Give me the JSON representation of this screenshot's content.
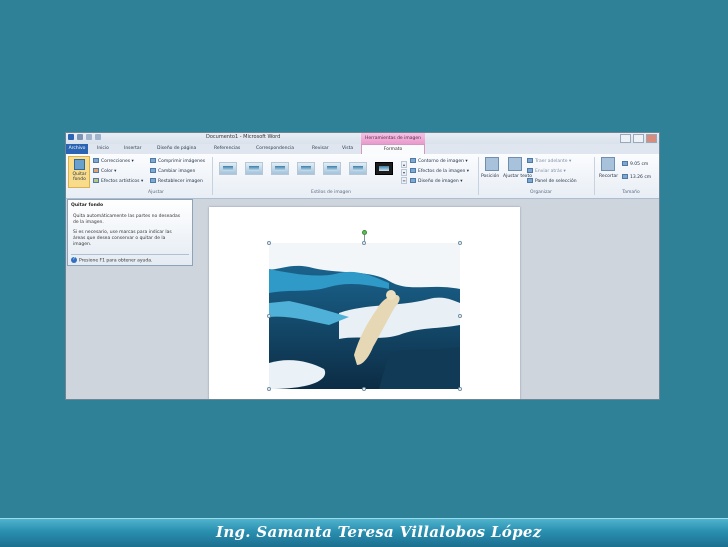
{
  "window": {
    "title": "Documento1 - Microsoft Word",
    "contextual_tab_group": "Herramientas de imagen"
  },
  "tabs": [
    "Archivo",
    "Inicio",
    "Insertar",
    "Diseño de página",
    "Referencias",
    "Correspondencia",
    "Revisar",
    "Vista",
    "Formato"
  ],
  "ribbon": {
    "remove_background": "Quitar fondo",
    "adjust": {
      "corrections": "Correcciones",
      "color": "Color",
      "artistic_effects": "Efectos artísticos",
      "compress": "Comprimir imágenes",
      "change": "Cambiar imagen",
      "reset": "Restablecer imagen",
      "group_label": "Ajustar"
    },
    "styles": {
      "group_label": "Estilos de imagen",
      "border": "Contorno de imagen",
      "effects": "Efectos de la imagen",
      "layout": "Diseño de imagen"
    },
    "arrange": {
      "position": "Posición",
      "wrap": "Ajustar texto",
      "bring_forward": "Traer adelante",
      "send_backward": "Enviar atrás",
      "selection_pane": "Panel de selección",
      "group_label": "Organizar"
    },
    "size": {
      "crop": "Recortar",
      "height": "9.05 cm",
      "width": "13.26 cm",
      "group_label": "Tamaño"
    }
  },
  "tooltip": {
    "title": "Quitar fondo",
    "body1": "Quita automáticamente las partes no deseadas de la imagen.",
    "body2": "Si es necesario, use marcas para indicar las áreas que desea conservar o quitar de la imagen.",
    "help": "Presione F1 para obtener ayuda."
  },
  "footer": {
    "author": "Ing. Samanta Teresa Villalobos López"
  },
  "colors": {
    "background": "#2f8197",
    "file_tab": "#2b64b3",
    "contextual": "#e79bcc"
  }
}
